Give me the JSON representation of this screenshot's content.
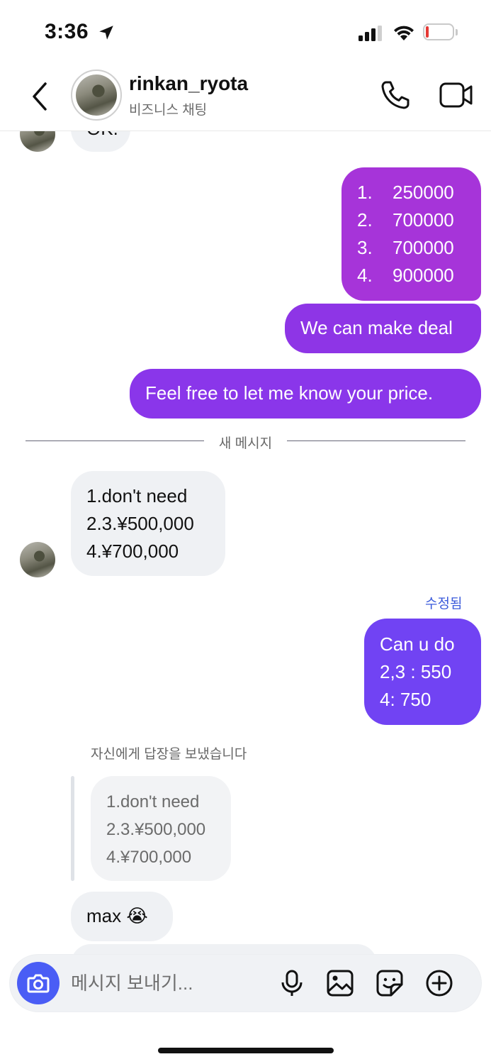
{
  "status_bar": {
    "time": "3:36",
    "battery": "8",
    "battery_level": 0.08,
    "icons": [
      "location-arrow-icon",
      "signal-icon",
      "wifi-icon",
      "battery-icon"
    ]
  },
  "header": {
    "username": "rinkan_ryota",
    "subtitle": "비즈니스 채팅",
    "icons": [
      "back-icon",
      "call-icon",
      "video-call-icon"
    ]
  },
  "messages": {
    "partial_top": "OK.",
    "price_list": [
      {
        "num": "1.",
        "value": "250000"
      },
      {
        "num": "2.",
        "value": "700000"
      },
      {
        "num": "3.",
        "value": "700000"
      },
      {
        "num": "4.",
        "value": "900000"
      }
    ],
    "deal": "We can make deal",
    "price_question": "Feel free to let me know your price.",
    "new_messages_divider": "새 메시지",
    "reply_in": [
      "1.don't need",
      "2.3.¥500,000",
      "4.¥700,000"
    ],
    "edited_label": "수정됨",
    "counter_offer": [
      "Can u do",
      "2,3 : 550",
      "4: 750"
    ],
    "reply_note": "자신에게 답장을 보냈습니다",
    "quoted": [
      "1.don't need",
      "2.3.¥500,000",
      "4.¥700,000"
    ],
    "max_text": "max",
    "max_emoji": "😭"
  },
  "composer": {
    "placeholder": "메시지 보내기...",
    "icons": [
      "camera-icon",
      "microphone-icon",
      "gallery-icon",
      "sticker-icon",
      "plus-icon"
    ]
  },
  "colors": {
    "outgoing_top": "#a634d9",
    "outgoing_mid": "#8a35e8",
    "outgoing_bottom": "#7143f3",
    "incoming": "#eff1f4",
    "accent_blue": "#4a5df5"
  }
}
